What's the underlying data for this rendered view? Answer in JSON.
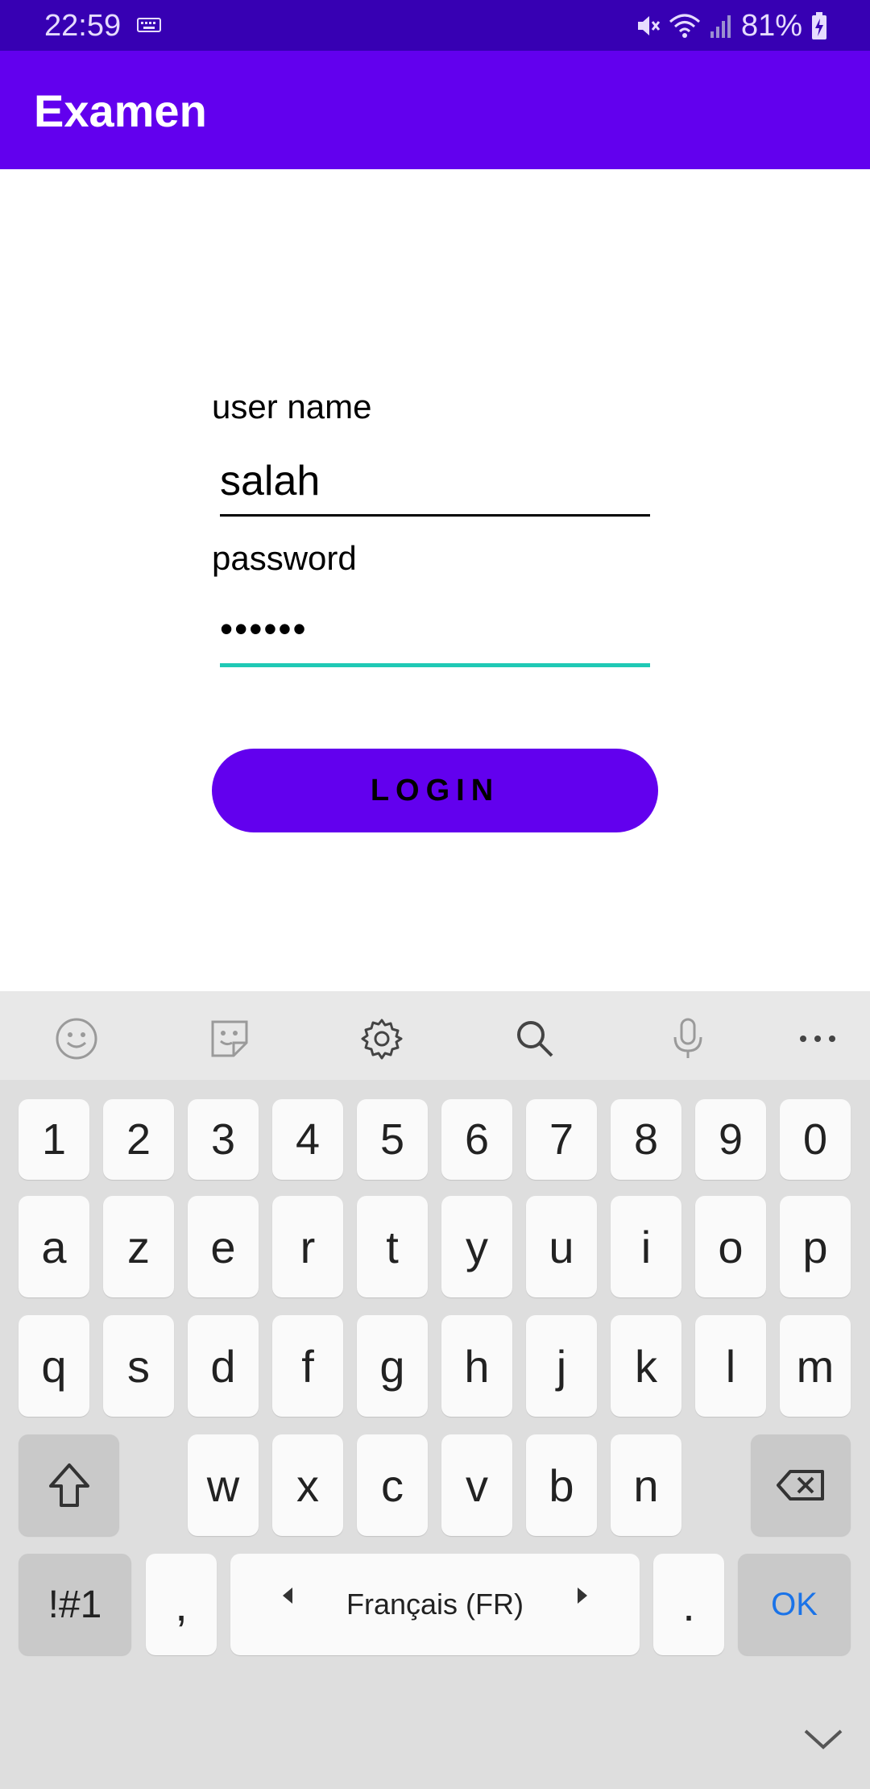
{
  "status_bar": {
    "time": "22:59",
    "battery": "81%",
    "icons": [
      "keyboard-icon",
      "mute-icon",
      "wifi-icon",
      "signal-icon",
      "battery-charging-icon"
    ]
  },
  "app_bar": {
    "title": "Examen"
  },
  "form": {
    "username_label": "user name",
    "username_value": "salah",
    "password_label": "password",
    "password_value": "••••••",
    "login_label": "LOGIN"
  },
  "keyboard": {
    "toolbar_icons": [
      "emoji-icon",
      "sticker-icon",
      "gear-icon",
      "search-icon",
      "microphone-icon",
      "more-icon"
    ],
    "number_row": [
      "1",
      "2",
      "3",
      "4",
      "5",
      "6",
      "7",
      "8",
      "9",
      "0"
    ],
    "row1": [
      "a",
      "z",
      "e",
      "r",
      "t",
      "y",
      "u",
      "i",
      "o",
      "p"
    ],
    "row2": [
      "q",
      "s",
      "d",
      "f",
      "g",
      "h",
      "j",
      "k",
      "l",
      "m"
    ],
    "row3": [
      "w",
      "x",
      "c",
      "v",
      "b",
      "n"
    ],
    "symbols_label": "!#1",
    "comma_label": ",",
    "space_label": "Français (FR)",
    "period_label": ".",
    "ok_label": "OK"
  },
  "colors": {
    "status_bar": "#3700b3",
    "primary": "#6200ee",
    "focus_underline": "#1fc9b5",
    "ok_text": "#1a73e8"
  }
}
